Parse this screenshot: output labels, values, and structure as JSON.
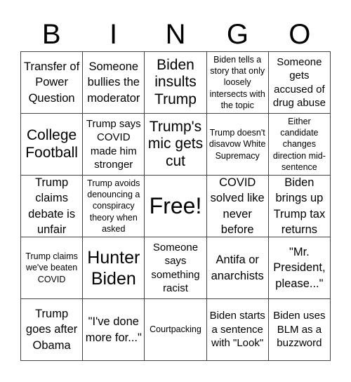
{
  "header": {
    "letters": [
      "B",
      "I",
      "N",
      "G",
      "O"
    ]
  },
  "cells": [
    [
      "Transfer of Power Question",
      "Someone bullies the moderator",
      "Biden insults Trump",
      "Biden tells a story that only loosely intersects with the topic",
      "Someone gets accused of drug abuse"
    ],
    [
      "College Football",
      "Trump says COVID made him stronger",
      "Trump's mic gets cut",
      "Trump doesn't disavow White Supremacy",
      "Either candidate changes direction mid-sentence"
    ],
    [
      "Trump claims debate is unfair",
      "Trump avoids denouncing a conspiracy theory when asked",
      "Free!",
      "COVID solved like never before",
      "Biden brings up Trump tax returns"
    ],
    [
      "Trump claims we've beaten COVID",
      "Hunter Biden",
      "Someone says something racist",
      "Antifa or anarchists",
      "\"Mr. President, please...\""
    ],
    [
      "Trump goes after Obama",
      "\"I've done more for...\"",
      "Courtpacking",
      "Biden starts a sentence with \"Look\"",
      "Biden uses BLM as a buzzword"
    ]
  ]
}
